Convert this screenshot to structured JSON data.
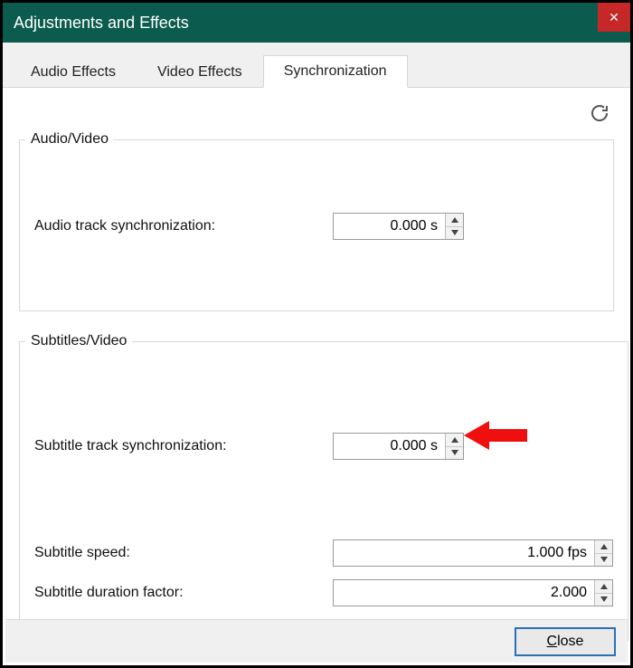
{
  "window": {
    "title": "Adjustments and Effects"
  },
  "tabs": {
    "audio_effects": "Audio Effects",
    "video_effects": "Video Effects",
    "synchronization": "Synchronization",
    "active": "synchronization"
  },
  "groups": {
    "audio_video": {
      "legend": "Audio/Video",
      "audio_track_sync_label": "Audio track synchronization:",
      "audio_track_sync_value": "0.000 s"
    },
    "subtitles_video": {
      "legend": "Subtitles/Video",
      "subtitle_track_sync_label": "Subtitle track synchronization:",
      "subtitle_track_sync_value": "0.000 s",
      "subtitle_speed_label": "Subtitle speed:",
      "subtitle_speed_value": "1.000 fps",
      "subtitle_duration_factor_label": "Subtitle duration factor:",
      "subtitle_duration_factor_value": "2.000"
    }
  },
  "footer": {
    "close_prefix": "C",
    "close_rest": "lose"
  }
}
